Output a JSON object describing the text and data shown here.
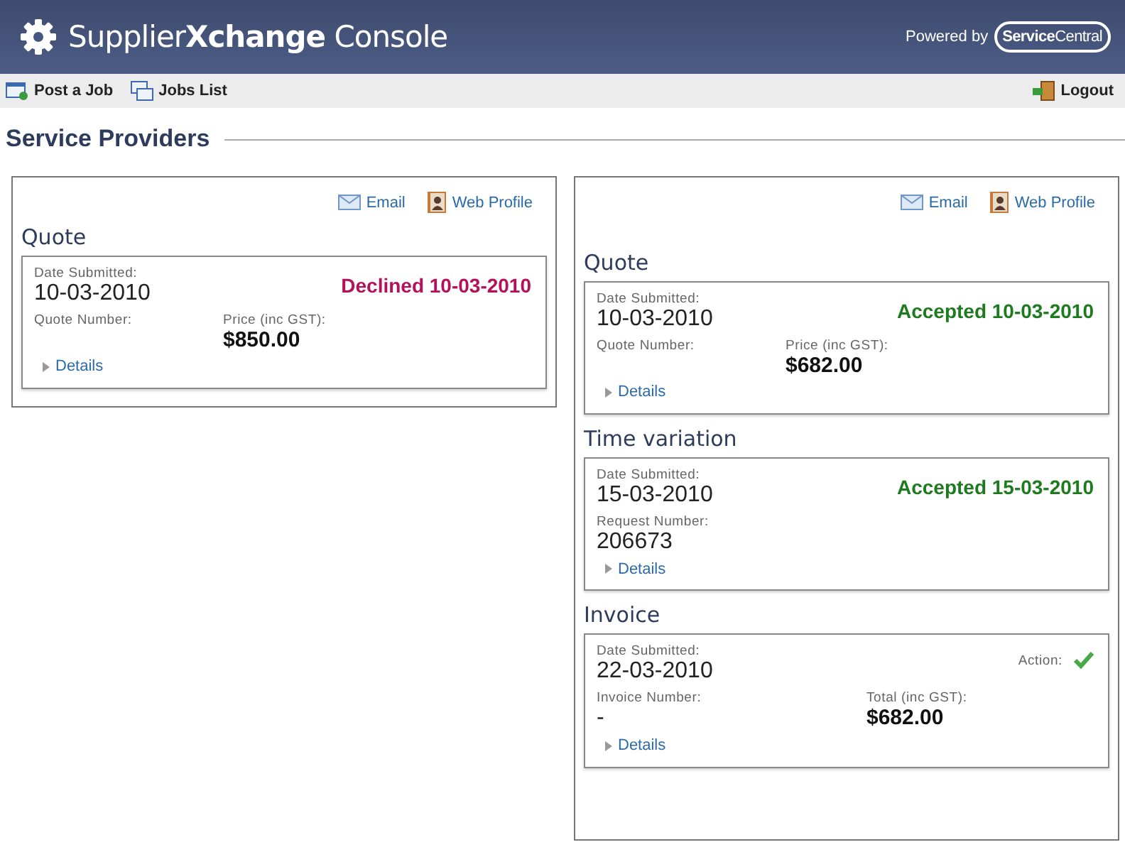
{
  "header": {
    "title": "Supplier**Xchange** Console",
    "powered_by": "Powered by",
    "brand": "**Service**Central"
  },
  "nav": {
    "left": [
      {
        "label": "Post a Job",
        "kind": "post"
      },
      {
        "label": "Jobs List",
        "kind": "list"
      }
    ],
    "right": [
      {
        "label": "Logout",
        "kind": "logout"
      }
    ]
  },
  "section_title": "Service Providers",
  "providers": [
    {
      "links": [
        "Email",
        "Web Profile"
      ],
      "cards": [
        {
          "heading": "Quote",
          "date_label": "Date Submitted:",
          "date": "10-03-2010",
          "status": {
            "kind": "declined",
            "text": "Declined 10-03-2010"
          },
          "number_label": "Quote Number:",
          "amount_label": "Price (inc GST):",
          "amount": "$850.00",
          "details": "Details"
        }
      ]
    },
    {
      "links": [
        "Email",
        "Web Profile"
      ],
      "cards": [
        {
          "heading": "Quote",
          "date_label": "Date Submitted:",
          "date": "10-03-2010",
          "status": {
            "kind": "accepted",
            "text": "Accepted 10-03-2010"
          },
          "number_label": "Quote Number:",
          "amount_label": "Price (inc GST):",
          "amount": "$682.00",
          "details": "Details"
        },
        {
          "heading": "Time variation",
          "date_label": "Date Submitted:",
          "date": "15-03-2010",
          "status": {
            "kind": "accepted",
            "text": "Accepted 15-03-2010"
          },
          "number_label": "Request Number:",
          "number": "206673",
          "details": "Details"
        },
        {
          "heading": "Invoice",
          "date_label": "Date Submitted:",
          "date": "22-03-2010",
          "action": {
            "label": "Action:",
            "kind": "check"
          },
          "number_label": "Invoice Number:",
          "number": "-",
          "amount_label": "Total (inc GST):",
          "amount": "$682.00",
          "details": "Details"
        }
      ]
    }
  ]
}
